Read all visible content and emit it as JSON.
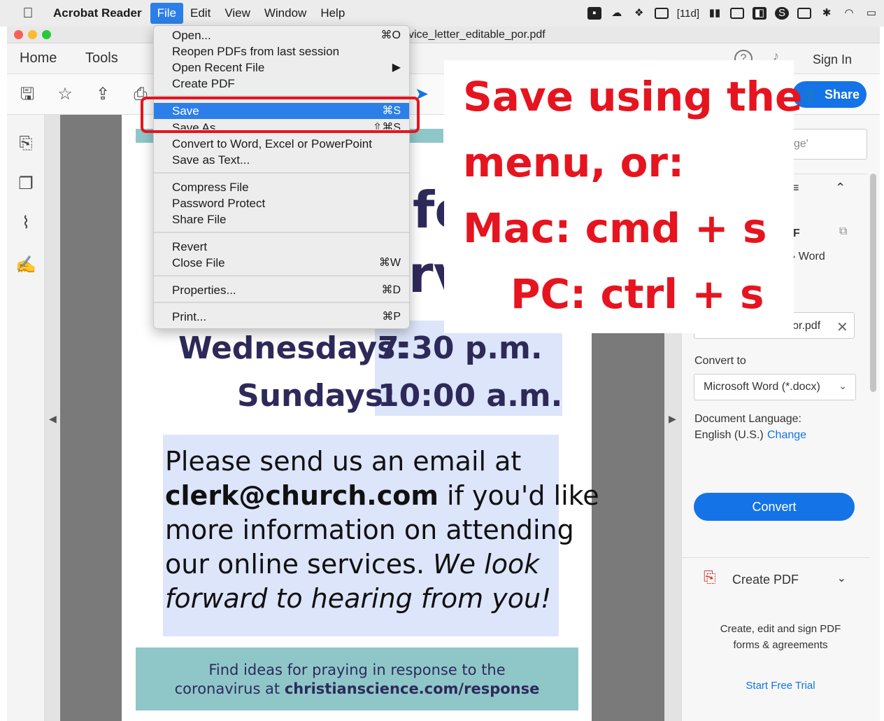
{
  "menubar": {
    "apple": "",
    "app_name": "Acrobat Reader",
    "items": [
      "File",
      "Edit",
      "View",
      "Window",
      "Help"
    ],
    "tray": {
      "badge": "[11d]",
      "icons": [
        "window-icon",
        "creative-cloud-icon",
        "dropbox-icon",
        "screen-icon",
        "audio-icon",
        "display-icon",
        "video-icon",
        "s-app-icon",
        "keyboard-icon",
        "bluetooth-icon",
        "wifi-icon",
        "airplay-icon"
      ]
    }
  },
  "window": {
    "doc_title": "vice_letter_editable_por.pdf"
  },
  "nav": {
    "home": "Home",
    "tools": "Tools",
    "help": "?",
    "sign_in": "Sign In"
  },
  "toolbar": {
    "share": "Share"
  },
  "file_menu": {
    "items": [
      {
        "label": "Open...",
        "shortcut": "⌘O"
      },
      {
        "label": "Reopen PDFs from last session",
        "shortcut": ""
      },
      {
        "label": "Open Recent File",
        "shortcut": "▶"
      },
      {
        "label": "Create PDF",
        "shortcut": ""
      },
      {
        "label": "Save",
        "shortcut": "⌘S"
      },
      {
        "label": "Save As",
        "shortcut": "⇧⌘S"
      },
      {
        "label": "Convert to Word, Excel or PowerPoint",
        "shortcut": ""
      },
      {
        "label": "Save as Text...",
        "shortcut": ""
      },
      {
        "label": "Compress File",
        "shortcut": ""
      },
      {
        "label": "Password Protect",
        "shortcut": ""
      },
      {
        "label": "Share File",
        "shortcut": ""
      },
      {
        "label": "Revert",
        "shortcut": ""
      },
      {
        "label": "Close File",
        "shortcut": "⌘W"
      },
      {
        "label": "Properties...",
        "shortcut": "⌘D"
      },
      {
        "label": "Print...",
        "shortcut": "⌘P"
      }
    ]
  },
  "annotation": {
    "line1": "Save using the",
    "line2": "menu, or:",
    "line3": "Mac: cmd + s",
    "line4": "PC: ctrl + s"
  },
  "document": {
    "frag_fo": "fo",
    "frag_rv": "rv",
    "wed_label": "Wednesdays:",
    "wed_time": "7:30 p.m.",
    "sun_label": "Sundays:",
    "sun_time": "10:00 a.m.",
    "msg_1": "Please send us an email at",
    "msg_email": "clerk@church.com",
    "msg_2": " if you'd like",
    "msg_3": "more information on attending",
    "msg_4": "our online services. ",
    "msg_4i": "We look",
    "msg_5i": "forward to hearing from you!",
    "footer_1": "Find ideas for praying in response to the",
    "footer_2a": "coronavirus at ",
    "footer_2b": "christianscience.com/response"
  },
  "right_panel": {
    "search_partial": "ge'",
    "row_partial_1": "F",
    "row_partial_2": "› Word",
    "file_partial": "ɔr.pdf",
    "convert_to_label": "Convert to",
    "convert_to_value": "Microsoft Word (*.docx)",
    "doc_lang_label": "Document Language:",
    "doc_lang_value": "English (U.S.)",
    "change_link": "Change",
    "convert_button": "Convert",
    "create_pdf": "Create PDF",
    "desc_1": "Create, edit and sign PDF",
    "desc_2": "forms & agreements",
    "trial_link": "Start Free Trial"
  }
}
